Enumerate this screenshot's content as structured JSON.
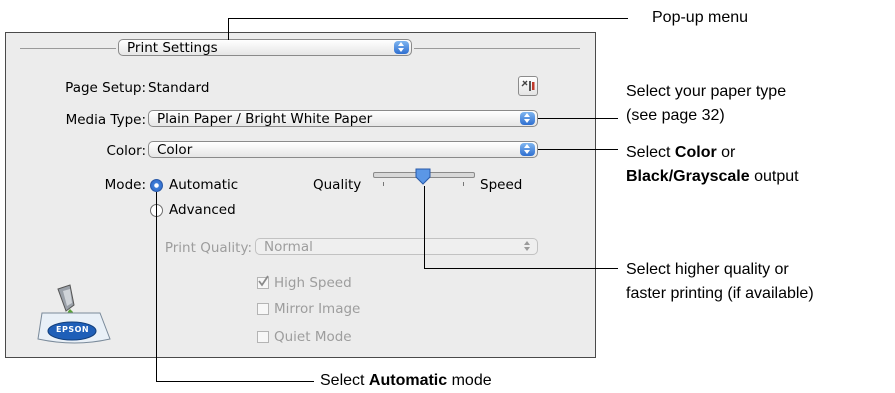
{
  "dialog": {
    "section_popup": "Print Settings",
    "page_setup_label": "Page Setup:",
    "page_setup_value": "Standard",
    "media_type_label": "Media Type:",
    "media_type_value": "Plain Paper / Bright White Paper",
    "color_label": "Color:",
    "color_value": "Color",
    "mode_label": "Mode:",
    "mode_automatic": "Automatic",
    "mode_advanced": "Advanced",
    "slider_left_label": "Quality",
    "slider_right_label": "Speed",
    "print_quality_label": "Print Quality:",
    "print_quality_value": "Normal",
    "checkbox_high_speed": "High Speed",
    "checkbox_mirror_image": "Mirror Image",
    "checkbox_quiet_mode": "Quiet Mode",
    "logo_text": "EPSON",
    "selected_mode": "Automatic",
    "slider_level": 0.5
  },
  "callouts": {
    "popup_menu": "Pop-up menu",
    "paper_type_line1": "Select your paper type",
    "paper_type_line2": "(see page 32)",
    "color_pre": "Select ",
    "color_bold": "Color",
    "color_post": " or",
    "color_line2_bold": "Black/Grayscale",
    "color_line2_post": " output",
    "quality_line1": "Select higher quality or",
    "quality_line2": "faster printing (if available)",
    "auto_pre": "Select ",
    "auto_bold": "Automatic",
    "auto_post": " mode"
  },
  "colors": {
    "accent": "#2f6fd0",
    "panel_bg": "#ececec"
  }
}
